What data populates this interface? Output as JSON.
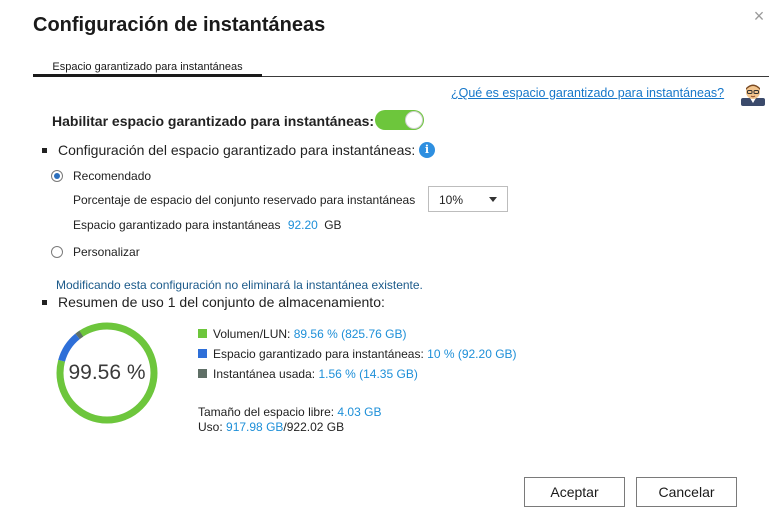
{
  "dialog": {
    "title": "Configuración de instantáneas",
    "close_symbol": "×"
  },
  "tabs": [
    {
      "label": "Espacio garantizado para instantáneas",
      "active": true
    }
  ],
  "help": {
    "link_text": "¿Qué es espacio garantizado para instantáneas?",
    "icon": "help-avatar-icon"
  },
  "enable": {
    "label": "Habilitar espacio garantizado para instantáneas:",
    "toggle_on": true,
    "toggle_color": "#6dc63c"
  },
  "config": {
    "title": "Configuración del espacio garantizado para instantáneas:",
    "info_symbol": "i",
    "recommended": {
      "label": "Recomendado",
      "selected": true,
      "percent_label": "Porcentaje de espacio del conjunto reservado para instantáneas",
      "percent_value": "10%",
      "guaranteed_label": "Espacio garantizado para instantáneas",
      "guaranteed_value": "92.20",
      "guaranteed_unit": "GB"
    },
    "custom": {
      "label": "Personalizar",
      "selected": false
    },
    "note": "Modificando esta configuración no eliminará la instantánea existente."
  },
  "summary": {
    "title": "Resumen de uso 1 del conjunto de almacenamiento:",
    "donut_label": "99.56 %",
    "legend": [
      {
        "name": "Volumen/LUN:",
        "value": "89.56 % (825.76 GB)",
        "color": "#6dc63c",
        "fraction": 0.8956
      },
      {
        "name": "Espacio garantizado para instantáneas:",
        "value": "10 % (92.20 GB)",
        "color": "#2e6fd8",
        "fraction": 0.1
      },
      {
        "name": "Instantánea usada:",
        "value": "1.56 % (14.35 GB)",
        "color": "#5f6f66",
        "fraction": 0.0156
      }
    ],
    "free_label": "Tamaño del espacio libre:",
    "free_value": "4.03 GB",
    "usage_label": "Uso:",
    "usage_used": "917.98 GB",
    "usage_total": "/922.02 GB"
  },
  "buttons": {
    "accept": "Aceptar",
    "cancel": "Cancelar"
  }
}
